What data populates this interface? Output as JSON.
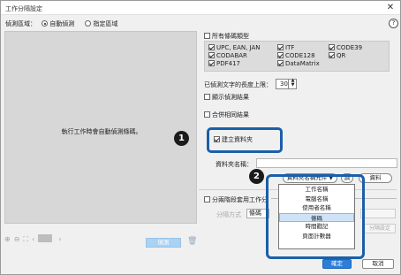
{
  "window": {
    "title": "工作分隔設定",
    "close_glyph": "✕"
  },
  "mode": {
    "label": "偵測區域：",
    "options": [
      "自動偵測",
      "指定區域"
    ],
    "selected": "自動偵測"
  },
  "help_glyph": "?",
  "preview": {
    "message": "執行工作時會自動偵測條碼。"
  },
  "left_toolbar": {
    "icons": [
      "zoom-in-icon",
      "zoom-out-icon",
      "fit-icon",
      "prev-icon",
      "next-icon"
    ],
    "detect_label": "偵測"
  },
  "barcode": {
    "all_types_label": "所有條碼類型",
    "types": [
      {
        "label": "UPC, EAN, JAN",
        "checked": true
      },
      {
        "label": "ITF",
        "checked": true
      },
      {
        "label": "CODE39",
        "checked": true
      },
      {
        "label": "CODABAR",
        "checked": true
      },
      {
        "label": "CODE128",
        "checked": true
      },
      {
        "label": "QR",
        "checked": true
      },
      {
        "label": "PDF417",
        "checked": true
      },
      {
        "label": "DataMatrix",
        "checked": true
      }
    ]
  },
  "max_length": {
    "label": "已偵測文字的長度上限：",
    "value": "30"
  },
  "show_results_label": "顯示偵測結果",
  "merge_label": "合併相同結果",
  "create_folder_label": "建立資料夾",
  "folder_name_label": "資料夾名稱：",
  "folder_dropdown_label": "資料夾名稱元件 ▼",
  "folder_buttons": {
    "left": "調",
    "right": "資料"
  },
  "split_label": "分兩階段套用工作分",
  "split_method": {
    "label": "分隔方式",
    "value": "條碼"
  },
  "split_right_button": "分隔設定",
  "menu_items": [
    "工作名稱",
    "電腦名稱",
    "使用者名稱",
    "條碼",
    "時間戳記",
    "頁面計數器"
  ],
  "menu_selected": "條碼",
  "badges": {
    "one": "1",
    "two": "2"
  },
  "footer": {
    "ok_label": "確定",
    "cancel_label": "取消"
  },
  "colors": {
    "highlight": "#1a5fa8",
    "primary": "#2b7fd9",
    "badge": "#1b1b1b"
  }
}
